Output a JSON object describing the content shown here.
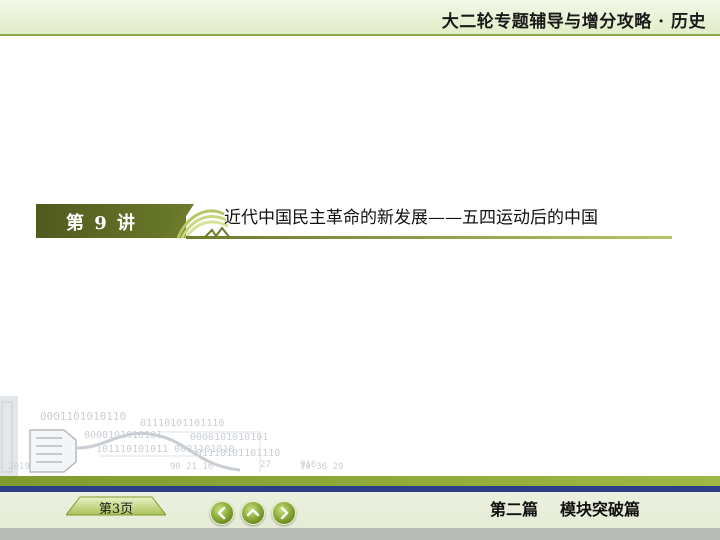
{
  "header": {
    "title": "大二轮专题辅导与增分攻略 · 历史"
  },
  "chapter": {
    "label": "第 9 讲",
    "title": "近代中国民主革命的新发展——五四运动后的中国"
  },
  "decor": {
    "binary_lines": [
      "0001101010110",
      "01110101101110",
      "0000101010101",
      "101110101011 0001101010",
      "01110101101110",
      "0000101010101",
      "01110101101110"
    ],
    "tick_labels": [
      "2019",
      "90 21 16",
      "10 36 29",
      "27",
      "916"
    ]
  },
  "footer": {
    "page_label": "第3页",
    "nav": {
      "prev": "previous-arrow",
      "home": "up-arrow",
      "next": "next-arrow"
    },
    "part_label": "第二篇",
    "module_label": "模块突破篇"
  },
  "colors": {
    "accent_green": "#6b7a2b",
    "strip_blue": "#2a3f84",
    "button_green": "#6e8f20"
  }
}
